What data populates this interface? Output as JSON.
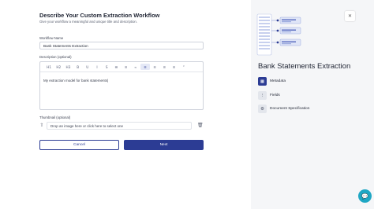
{
  "form": {
    "title": "Describe Your Custom Extraction Workflow",
    "subtitle": "Give your workflow a meaningful and unique title and description.",
    "workflow_name_label": "Workflow Name",
    "workflow_name_value": "Bank Statements Extraction",
    "description_label": "Description (optional)",
    "description_value": "My extraction model for bank statements|",
    "thumbnail_label": "Thumbnail (optional)",
    "thumbnail_placeholder": "Drop an image here or click here to select one",
    "cancel_label": "Cancel",
    "next_label": "Next"
  },
  "toolbar": {
    "items": [
      {
        "icon": "heading-1-icon",
        "glyph": "H1",
        "active": false
      },
      {
        "icon": "heading-2-icon",
        "glyph": "H2",
        "active": false
      },
      {
        "icon": "heading-3-icon",
        "glyph": "H3",
        "active": false
      },
      {
        "icon": "bold-icon",
        "glyph": "B",
        "active": false
      },
      {
        "icon": "underline-icon",
        "glyph": "U",
        "active": false
      },
      {
        "icon": "italic-icon",
        "glyph": "I",
        "active": false
      },
      {
        "icon": "strikethrough-icon",
        "glyph": "S",
        "active": false
      },
      {
        "icon": "bullet-list-icon",
        "glyph": "☰",
        "active": false
      },
      {
        "icon": "numbered-list-icon",
        "glyph": "≡",
        "active": false
      },
      {
        "icon": "link-icon",
        "glyph": "∞",
        "active": false
      },
      {
        "icon": "align-left-icon",
        "glyph": "≡",
        "active": true
      },
      {
        "icon": "align-center-icon",
        "glyph": "≡",
        "active": false
      },
      {
        "icon": "align-right-icon",
        "glyph": "≡",
        "active": false
      },
      {
        "icon": "align-justify-icon",
        "glyph": "≡",
        "active": false
      },
      {
        "icon": "quote-icon",
        "glyph": "”",
        "active": false
      }
    ]
  },
  "panel": {
    "title": "Bank Statements Extraction",
    "nav": [
      {
        "label": "Metadata",
        "icon": "metadata-icon",
        "active": true
      },
      {
        "label": "Fields",
        "icon": "fields-icon",
        "active": false
      },
      {
        "label": "Document Specification",
        "icon": "document-spec-icon",
        "active": false
      }
    ]
  },
  "colors": {
    "primary": "#2c3c94",
    "panel_bg": "#f5f6f8",
    "chat": "#1fa7c4"
  }
}
